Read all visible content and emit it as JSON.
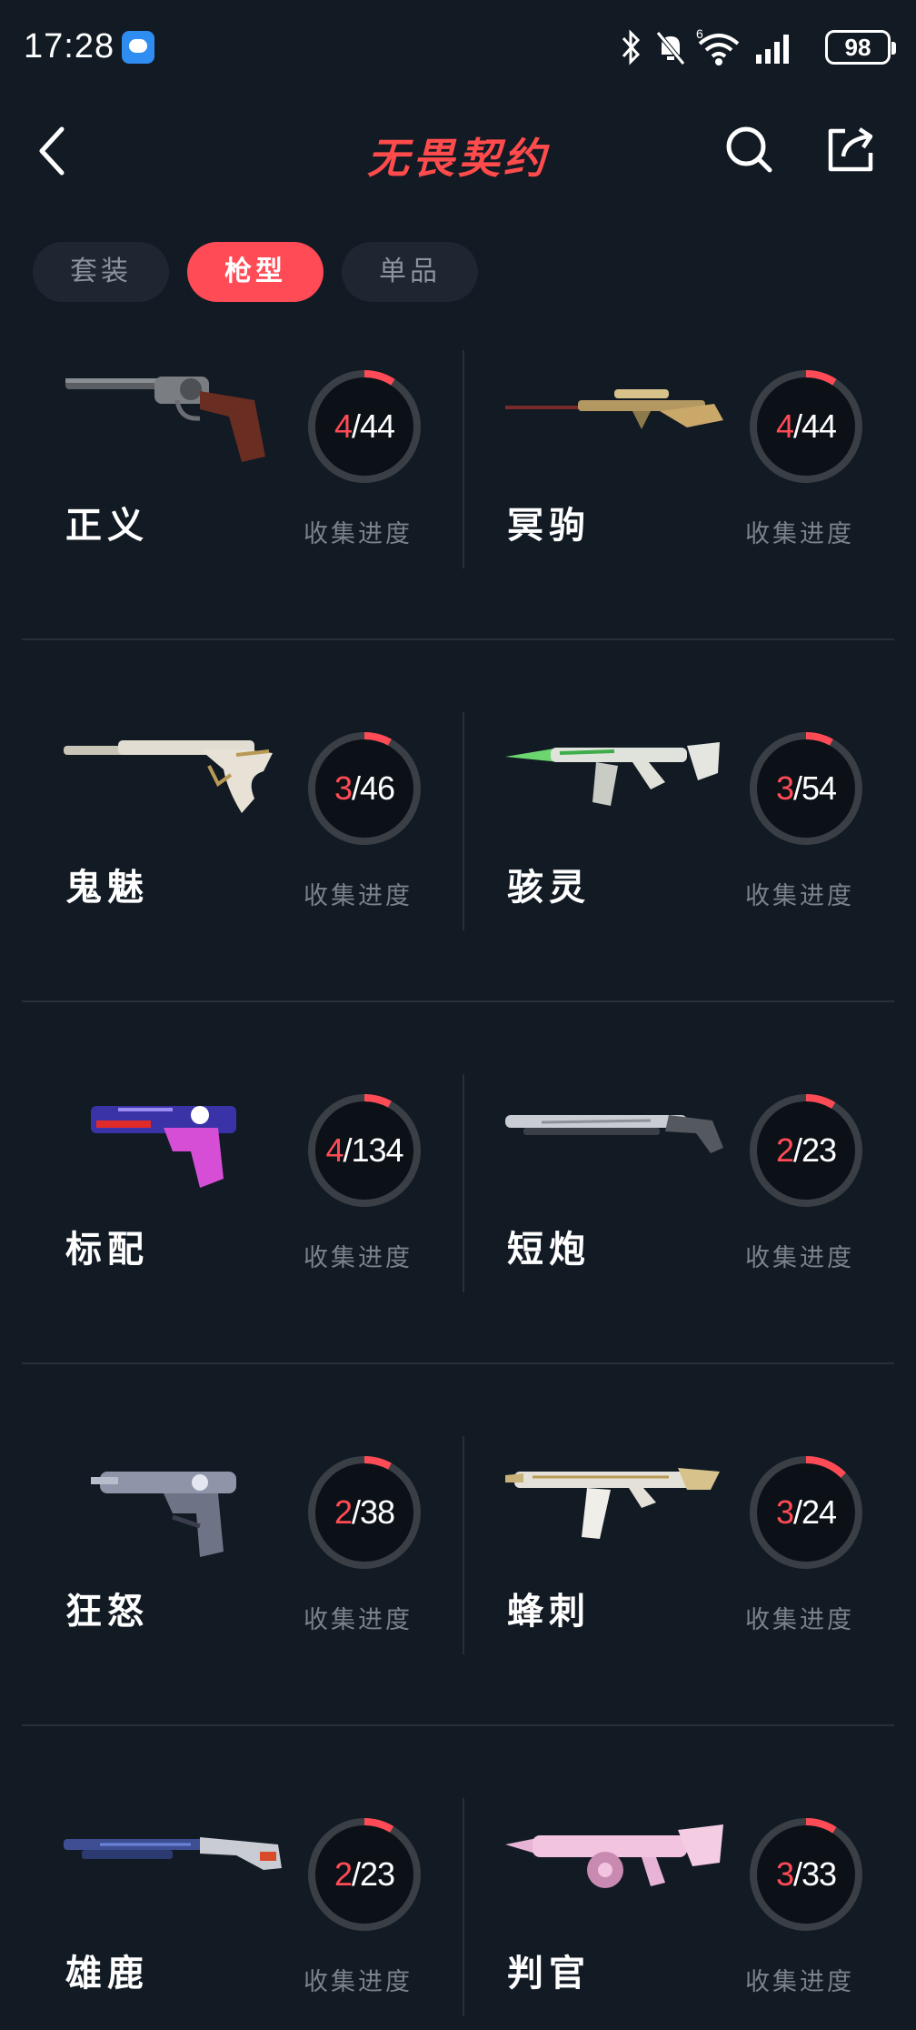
{
  "status": {
    "time": "17:28",
    "battery": "98",
    "network": "6"
  },
  "header": {
    "title": "无畏契约"
  },
  "tabs": [
    {
      "label": "套装",
      "active": false
    },
    {
      "label": "枪型",
      "active": true
    },
    {
      "label": "单品",
      "active": false
    }
  ],
  "progress_label": "收集进度",
  "colors": {
    "accent": "#ff4b55",
    "background": "#121a24",
    "card_text": "#ffffff"
  },
  "weapons": [
    {
      "name": "正义",
      "collected": 4,
      "total": 44,
      "icon": "revolver-icon"
    },
    {
      "name": "冥驹",
      "collected": 4,
      "total": 44,
      "icon": "sniper-rifle-icon"
    },
    {
      "name": "鬼魅",
      "collected": 3,
      "total": 46,
      "icon": "pistol-icon"
    },
    {
      "name": "骇灵",
      "collected": 3,
      "total": 54,
      "icon": "rifle-icon"
    },
    {
      "name": "标配",
      "collected": 4,
      "total": 134,
      "icon": "handgun-icon"
    },
    {
      "name": "短炮",
      "collected": 2,
      "total": 23,
      "icon": "shotgun-icon"
    },
    {
      "name": "狂怒",
      "collected": 2,
      "total": 38,
      "icon": "machine-pistol-icon"
    },
    {
      "name": "蜂刺",
      "collected": 3,
      "total": 24,
      "icon": "smg-icon"
    },
    {
      "name": "雄鹿",
      "collected": 2,
      "total": 23,
      "icon": "pump-shotgun-icon"
    },
    {
      "name": "判官",
      "collected": 3,
      "total": 33,
      "icon": "auto-shotgun-icon"
    }
  ]
}
